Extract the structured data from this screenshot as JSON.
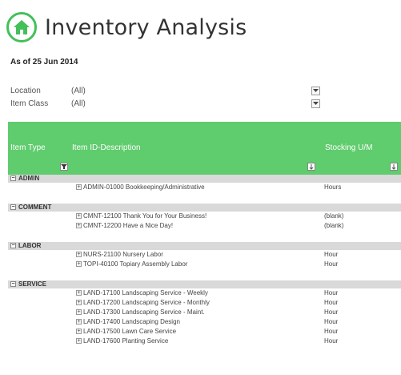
{
  "header": {
    "icon": "home-icon",
    "title": "Inventory Analysis",
    "as_of": "As of 25 Jun 2014"
  },
  "filters": [
    {
      "label": "Location",
      "value": "(All)"
    },
    {
      "label": "Item Class",
      "value": "(All)"
    }
  ],
  "table": {
    "columns": {
      "item_type": "Item Type",
      "item_id": "Item ID-Description",
      "stocking": "Stocking U/M"
    },
    "groups": [
      {
        "name": "ADMIN",
        "items": [
          {
            "desc": "ADMIN-01000 Bookkeeping/Administrative",
            "uom": "Hours"
          }
        ]
      },
      {
        "name": "COMMENT",
        "items": [
          {
            "desc": "CMNT-12100 Thank You for Your Business!",
            "uom": "(blank)"
          },
          {
            "desc": "CMNT-12200 Have a Nice Day!",
            "uom": "(blank)"
          }
        ]
      },
      {
        "name": "LABOR",
        "items": [
          {
            "desc": "NURS-21100 Nursery Labor",
            "uom": "Hour"
          },
          {
            "desc": "TOPI-40100 Topiary Assembly Labor",
            "uom": "Hour"
          }
        ]
      },
      {
        "name": "SERVICE",
        "items": [
          {
            "desc": "LAND-17100 Landscaping Service - Weekly",
            "uom": "Hour"
          },
          {
            "desc": "LAND-17200 Landscaping Service - Monthly",
            "uom": "Hour"
          },
          {
            "desc": "LAND-17300 Landscaping Service - Maint.",
            "uom": "Hour"
          },
          {
            "desc": "LAND-17400 Landscaping Design",
            "uom": "Hour"
          },
          {
            "desc": "LAND-17500 Lawn Care Service",
            "uom": "Hour"
          },
          {
            "desc": "LAND-17600 Planting Service",
            "uom": "Hour"
          }
        ]
      }
    ]
  },
  "colors": {
    "accent": "#5fcc6d",
    "icon_ring": "#43c05a",
    "group_band": "#d9d9d9"
  }
}
